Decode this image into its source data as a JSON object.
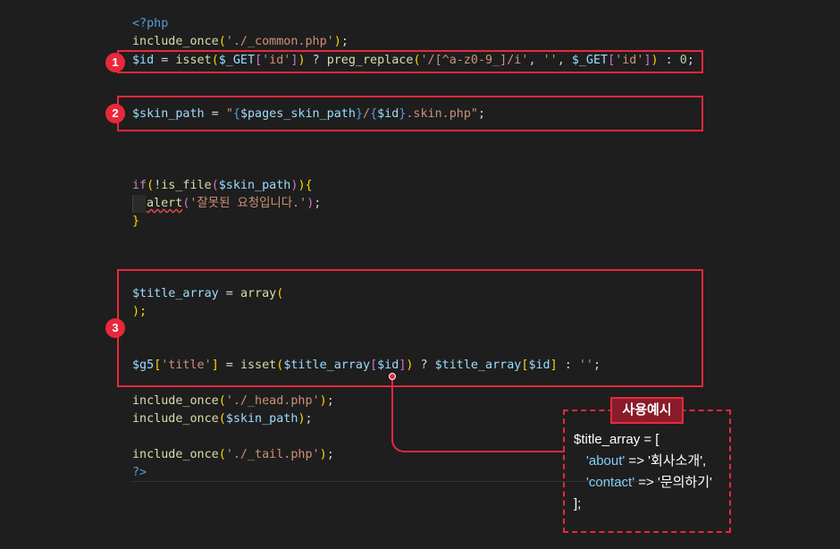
{
  "code": {
    "php_open": "<?php",
    "line_include_common": {
      "fn": "include_once",
      "arg": "'./_common.php'",
      "end": ";"
    },
    "line_id": {
      "var": "$id",
      "eq": " = ",
      "fn": "isset",
      "get1": "$_GET",
      "key1": "'id'",
      "ternary": " ? ",
      "fn2": "preg_replace",
      "regex": "'/[^a-z0-9_]/i'",
      "comma1": ", ",
      "empty": "''",
      "comma2": ", ",
      "get2": "$_GET",
      "key2": "'id'",
      "colon": " : ",
      "zero": "0",
      "end": ";"
    },
    "line_skin": {
      "var": "$skin_path",
      "eq": " = ",
      "q1": "\"",
      "v1": "$pages_skin_path",
      "sep": "/",
      "v2": "$id",
      "rest": ".skin.php\"",
      "end": ";"
    },
    "line_if": {
      "kw": "if",
      "bang": "!",
      "fn": "is_file",
      "var": "$skin_path",
      "brace": "{"
    },
    "line_alert": {
      "fn": "alert",
      "str": "'잘못된 요청입니다.'",
      "end": ";"
    },
    "line_close": "}",
    "line_title_array": {
      "var": "$title_array",
      "eq": " = ",
      "fn": "array"
    },
    "line_title_close": ");",
    "line_g5": {
      "var": "$g5",
      "key": "'title'",
      "eq": " = ",
      "fn": "isset",
      "var2": "$title_array",
      "var3": "$id",
      "ternary": " ? ",
      "var4": "$title_array",
      "var5": "$id",
      "colon": " : ",
      "empty": "''",
      "end": ";"
    },
    "line_head": {
      "fn": "include_once",
      "arg": "'./_head.php'",
      "end": ";"
    },
    "line_skin_inc": {
      "fn": "include_once",
      "var": "$skin_path",
      "end": ";"
    },
    "line_tail": {
      "fn": "include_once",
      "arg": "'./_tail.php'",
      "end": ";"
    },
    "php_close": "?>"
  },
  "badges": [
    "1",
    "2",
    "3"
  ],
  "example": {
    "title": "사용예시",
    "line1": "$title_array = [",
    "line2_key": "'about'",
    "line2_arrow": " => ",
    "line2_val": "'회사소개',",
    "line3_key": "'contact'",
    "line3_arrow": " => ",
    "line3_val": "'문의하기'",
    "line4": "];"
  },
  "colors": {
    "accent": "#e8283c",
    "background": "#1e1e1e"
  }
}
